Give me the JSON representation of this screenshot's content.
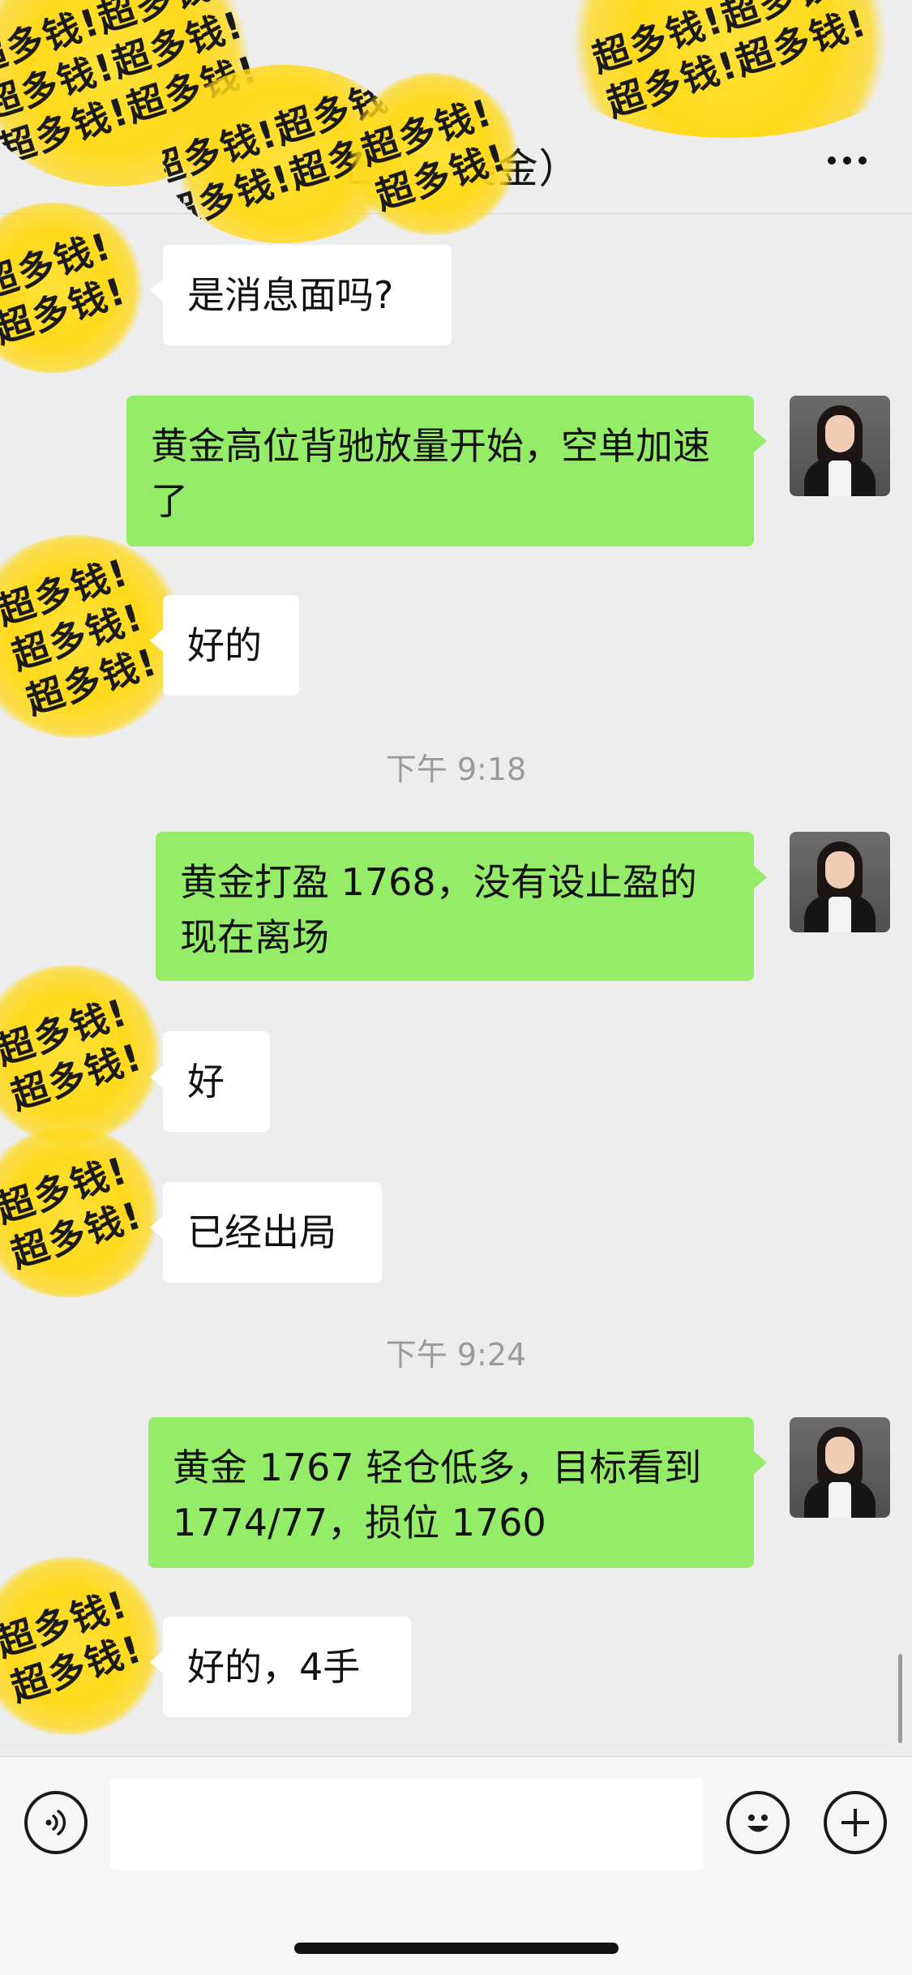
{
  "header": {
    "title": "上　万美金）",
    "more_icon": "more-dots-icon"
  },
  "sticker_text": "超多钱!",
  "messages": [
    {
      "side": "in",
      "text": "是消息面吗?"
    },
    {
      "side": "out",
      "text": "黄金高位背驰放量开始，空单加速了"
    },
    {
      "side": "in",
      "text": "好的"
    },
    {
      "type": "time",
      "text": "下午 9:18"
    },
    {
      "side": "out",
      "text": "黄金打盈 1768，没有设止盈的现在离场"
    },
    {
      "side": "in",
      "text": "好"
    },
    {
      "side": "in",
      "text": "已经出局"
    },
    {
      "type": "time",
      "text": "下午 9:24"
    },
    {
      "side": "out",
      "text": "黄金 1767 轻仓低多，目标看到 1774/77，损位 1760"
    },
    {
      "side": "in",
      "text": "好的，4手"
    }
  ],
  "input_bar": {
    "voice_icon": "voice-icon",
    "emoji_icon": "emoji-icon",
    "plus_icon": "plus-icon",
    "input_value": ""
  },
  "colors": {
    "background": "#ededed",
    "bubble_out": "#95ec69",
    "bubble_in": "#ffffff",
    "sticker": "#ffd91a"
  }
}
